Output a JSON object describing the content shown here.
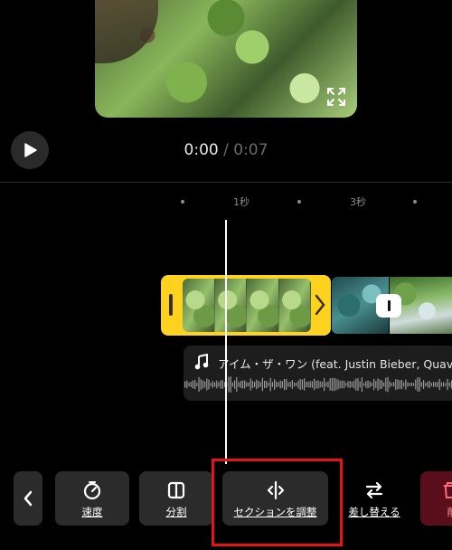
{
  "player": {
    "current_time": "0:00",
    "separator": "/",
    "total_time": "0:07"
  },
  "ruler": {
    "labels": [
      "1秒",
      "3秒"
    ]
  },
  "audio_track": {
    "title": "アイム・ザ・ワン (feat. Justin Bieber, Quavo"
  },
  "toolbar": {
    "speed_label": "速度",
    "split_label": "分割",
    "adjust_section_label": "セクションを調整",
    "replace_label": "差し替える",
    "delete_label": "削"
  },
  "colors": {
    "selected_clip": "#ffd21f",
    "highlight": "#e31414"
  }
}
